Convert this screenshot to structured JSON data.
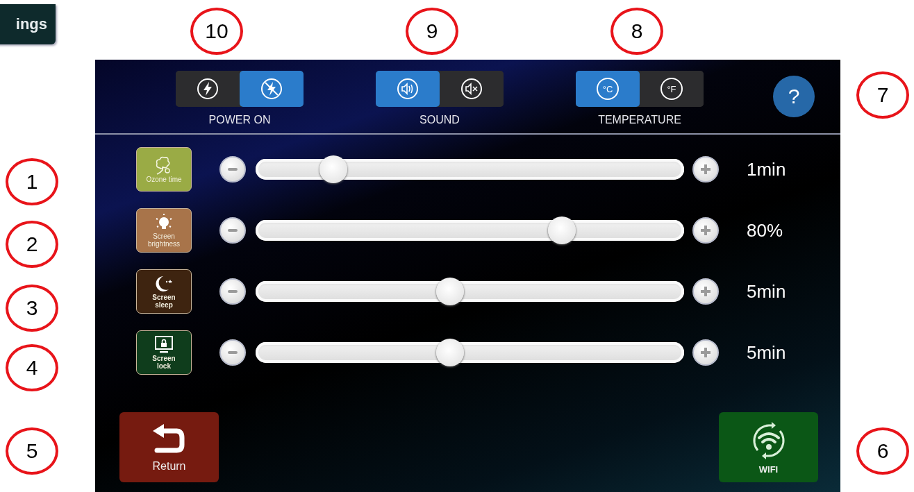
{
  "corner_button": {
    "label": "ings"
  },
  "callouts": [
    {
      "number": "10"
    },
    {
      "number": "9"
    },
    {
      "number": "8"
    },
    {
      "number": "7"
    },
    {
      "number": "1"
    },
    {
      "number": "2"
    },
    {
      "number": "3"
    },
    {
      "number": "4"
    },
    {
      "number": "5"
    },
    {
      "number": "6"
    }
  ],
  "toggle_groups": [
    {
      "label": "POWER ON",
      "options": [
        {
          "kind": "power",
          "selected": false
        },
        {
          "kind": "power-off",
          "selected": true
        }
      ]
    },
    {
      "label": "SOUND",
      "options": [
        {
          "kind": "sound",
          "selected": true
        },
        {
          "kind": "mute",
          "selected": false
        }
      ]
    },
    {
      "label": "TEMPERATURE",
      "options": [
        {
          "kind": "text",
          "text": "°C",
          "selected": true
        },
        {
          "kind": "text",
          "text": "°F",
          "selected": false
        }
      ]
    }
  ],
  "help": {
    "label": "?"
  },
  "settings": [
    {
      "kind": "ozone",
      "label": "Ozone time",
      "color": "#9aab45",
      "level": 0.16,
      "reading": "1min"
    },
    {
      "kind": "brightness",
      "label": "Screen brightness",
      "color": "#a8744a",
      "level": 0.73,
      "reading": "80%"
    },
    {
      "kind": "sleep",
      "label": "Screen sleep",
      "color": "#3e2410",
      "level": 0.45,
      "reading": "5min"
    },
    {
      "kind": "lock",
      "label": "Screen lock",
      "color": "#0f3d1c",
      "level": 0.45,
      "reading": "5min"
    }
  ],
  "buttons": [
    {
      "kind": "return",
      "label": "Return"
    },
    {
      "kind": "wifi",
      "label": "WIFI"
    }
  ]
}
